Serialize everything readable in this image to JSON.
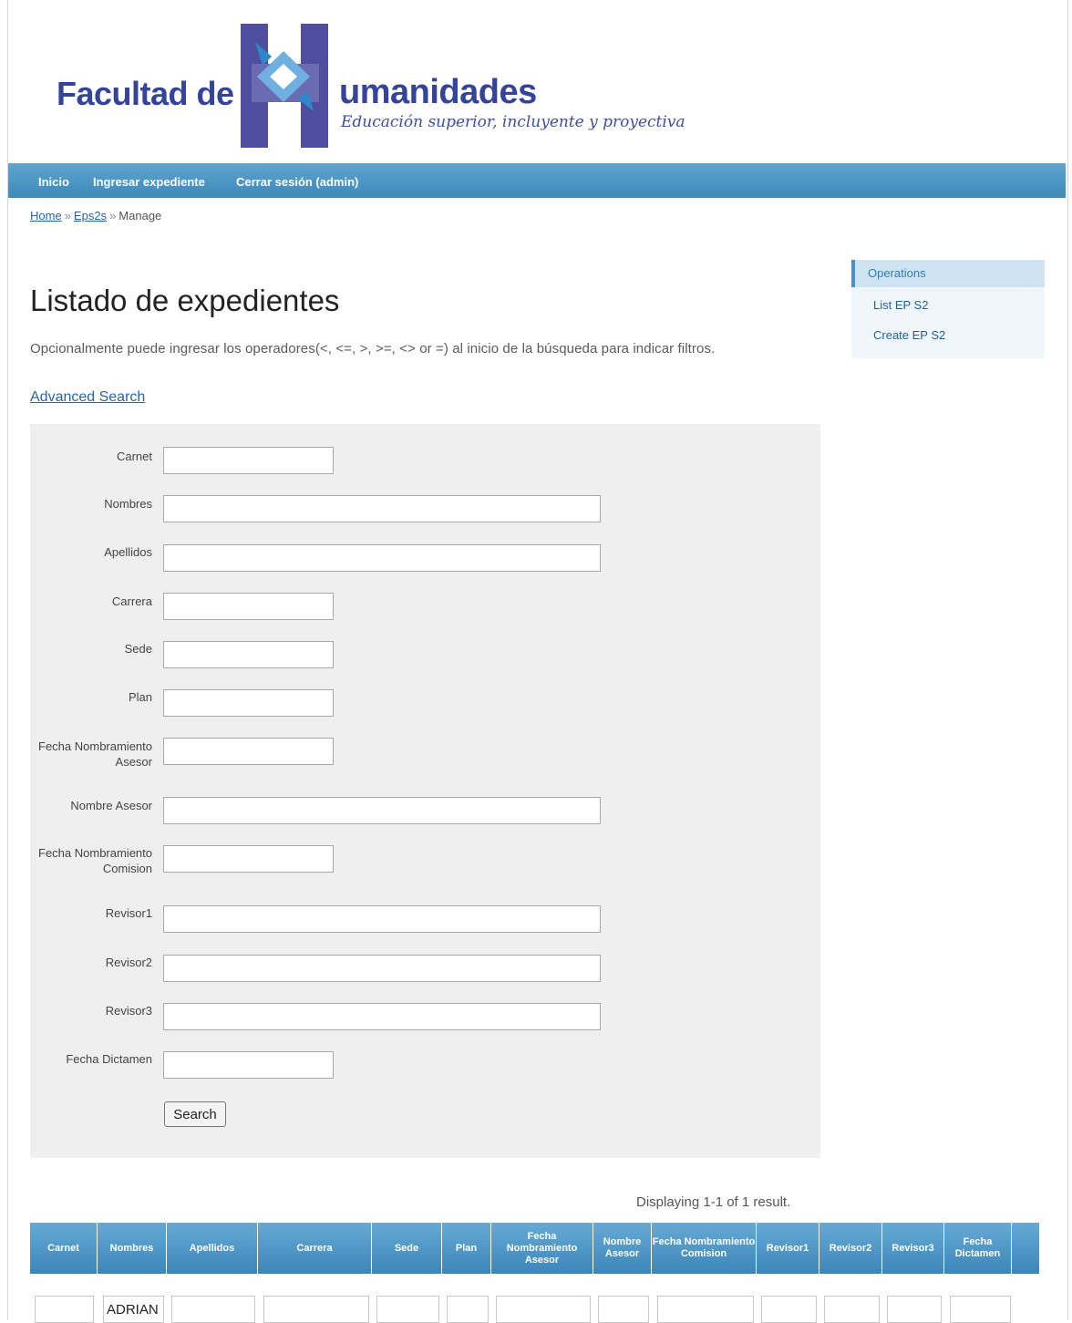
{
  "header": {
    "logo_left": "Facultad de",
    "logo_right": "umanidades",
    "tagline": "Educación superior, incluyente y proyectiva"
  },
  "nav": [
    "Inicio",
    "Ingresar expediente",
    "Cerrar sesión (admin)"
  ],
  "breadcrumb": {
    "items": [
      "Home",
      "Eps2s"
    ],
    "current": "Manage",
    "separator": "»"
  },
  "sidebar": {
    "title": "Operations",
    "items": [
      "List EP S2",
      "Create EP S2"
    ]
  },
  "main": {
    "title": "Listado de expedientes",
    "hint": "Opcionalmente puede ingresar los operadores(<, <=, >, >=, <> or =) al inicio de la búsqueda para indicar filtros.",
    "advanced_search": "Advanced Search"
  },
  "search_form": {
    "fields": [
      {
        "label": "Carnet",
        "value": ""
      },
      {
        "label": "Nombres",
        "value": ""
      },
      {
        "label": "Apellidos",
        "value": ""
      },
      {
        "label": "Carrera",
        "value": ""
      },
      {
        "label": "Sede",
        "value": ""
      },
      {
        "label": "Plan",
        "value": ""
      },
      {
        "label": "Fecha Nombramiento Asesor",
        "value": ""
      },
      {
        "label": "Nombre Asesor",
        "value": ""
      },
      {
        "label": "Fecha Nombramiento Comision",
        "value": ""
      },
      {
        "label": "Revisor1",
        "value": ""
      },
      {
        "label": "Revisor2",
        "value": ""
      },
      {
        "label": "Revisor3",
        "value": ""
      },
      {
        "label": "Fecha Dictamen",
        "value": ""
      }
    ],
    "submit_label": "Search"
  },
  "results": {
    "summary": "Displaying 1-1 of 1 result.",
    "columns": [
      "Carnet",
      "Nombres",
      "Apellidos",
      "Carrera",
      "Sede",
      "Plan",
      "Fecha Nombramiento Asesor",
      "Nombre Asesor",
      "Fecha Nombramiento Comision",
      "Revisor1",
      "Revisor2",
      "Revisor3",
      "Fecha Dictamen"
    ],
    "filter_row": [
      "",
      "ADRIAN",
      "",
      "",
      "",
      "",
      "",
      "",
      "",
      "",
      "",
      "",
      ""
    ]
  },
  "colors": {
    "nav": "#4b95c4",
    "brand": "#33449a",
    "panel": "#efefef",
    "link": "#2a64a4"
  }
}
